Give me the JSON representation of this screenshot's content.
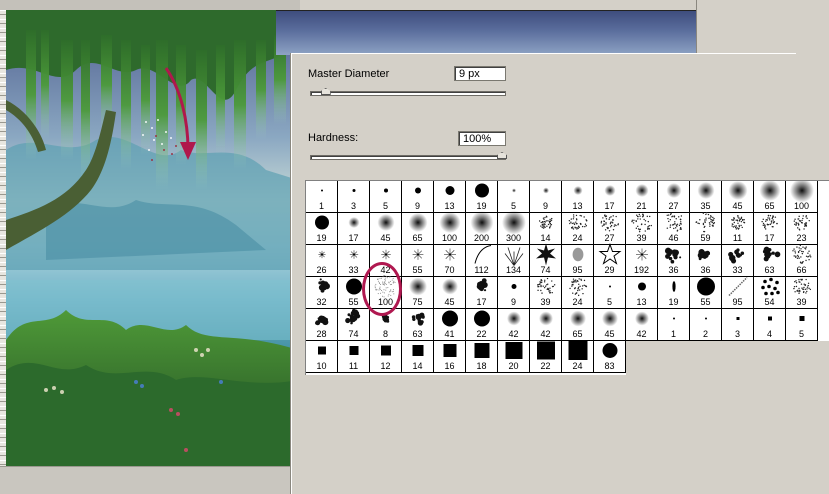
{
  "palette": {
    "master_diameter": {
      "label": "Master Diameter",
      "value": "9 px",
      "fraction": 0.05
    },
    "hardness": {
      "label": "Hardness:",
      "value": "100%",
      "fraction": 1.0
    }
  },
  "brushes": {
    "rows": [
      [
        {
          "n": "1",
          "k": "hard",
          "s": 2
        },
        {
          "n": "3",
          "k": "hard",
          "s": 3
        },
        {
          "n": "5",
          "k": "hard",
          "s": 4
        },
        {
          "n": "9",
          "k": "hard",
          "s": 6
        },
        {
          "n": "13",
          "k": "hard",
          "s": 9
        },
        {
          "n": "19",
          "k": "hard",
          "s": 14
        },
        {
          "n": "5",
          "k": "soft",
          "s": 4
        },
        {
          "n": "9",
          "k": "soft",
          "s": 6
        },
        {
          "n": "13",
          "k": "soft",
          "s": 9
        },
        {
          "n": "17",
          "k": "soft",
          "s": 11
        },
        {
          "n": "21",
          "k": "soft",
          "s": 13
        },
        {
          "n": "27",
          "k": "soft",
          "s": 15
        },
        {
          "n": "35",
          "k": "soft",
          "s": 17
        },
        {
          "n": "45",
          "k": "soft",
          "s": 19
        },
        {
          "n": "65",
          "k": "soft",
          "s": 21
        },
        {
          "n": "100",
          "k": "soft",
          "s": 24
        }
      ],
      [
        {
          "n": "19",
          "k": "hard",
          "s": 14
        },
        {
          "n": "17",
          "k": "soft",
          "s": 11
        },
        {
          "n": "45",
          "k": "soft",
          "s": 17
        },
        {
          "n": "65",
          "k": "soft",
          "s": 19
        },
        {
          "n": "100",
          "k": "soft",
          "s": 21
        },
        {
          "n": "200",
          "k": "soft",
          "s": 23
        },
        {
          "n": "300",
          "k": "soft",
          "s": 24
        },
        {
          "n": "14",
          "k": "scatter",
          "s": 14
        },
        {
          "n": "24",
          "k": "scatter",
          "s": 18
        },
        {
          "n": "27",
          "k": "scatter",
          "s": 18
        },
        {
          "n": "39",
          "k": "scatter",
          "s": 20
        },
        {
          "n": "46",
          "k": "scatter",
          "s": 20
        },
        {
          "n": "59",
          "k": "scatter",
          "s": 20
        },
        {
          "n": "11",
          "k": "scatter",
          "s": 14
        },
        {
          "n": "17",
          "k": "scatter",
          "s": 16
        },
        {
          "n": "23",
          "k": "scatter",
          "s": 16
        }
      ],
      [
        {
          "n": "26",
          "k": "star",
          "s": 12
        },
        {
          "n": "33",
          "k": "star",
          "s": 14
        },
        {
          "n": "42",
          "k": "star",
          "s": 16
        },
        {
          "n": "55",
          "k": "star",
          "s": 18
        },
        {
          "n": "70",
          "k": "star",
          "s": 20
        },
        {
          "n": "112",
          "k": "curve",
          "s": 22
        },
        {
          "n": "134",
          "k": "grass",
          "s": 22
        },
        {
          "n": "74",
          "k": "leaf",
          "s": 18
        },
        {
          "n": "95",
          "k": "gleaf",
          "s": 18
        },
        {
          "n": "29",
          "k": "outline-star",
          "s": 18
        },
        {
          "n": "192",
          "k": "star",
          "s": 20
        },
        {
          "n": "36",
          "k": "splat",
          "s": 20
        },
        {
          "n": "36",
          "k": "splat",
          "s": 20
        },
        {
          "n": "33",
          "k": "splat",
          "s": 20
        },
        {
          "n": "63",
          "k": "splat",
          "s": 20
        },
        {
          "n": "66",
          "k": "scatter",
          "s": 20
        }
      ],
      [
        {
          "n": "32",
          "k": "splat",
          "s": 20
        },
        {
          "n": "55",
          "k": "hard",
          "s": 16
        },
        {
          "n": "100",
          "k": "noise",
          "s": 22
        },
        {
          "n": "75",
          "k": "soft",
          "s": 18
        },
        {
          "n": "45",
          "k": "soft",
          "s": 16
        },
        {
          "n": "17",
          "k": "splat",
          "s": 16
        },
        {
          "n": "9",
          "k": "hard",
          "s": 5
        },
        {
          "n": "39",
          "k": "scatter",
          "s": 18
        },
        {
          "n": "24",
          "k": "scatter",
          "s": 18
        },
        {
          "n": "5",
          "k": "hard",
          "s": 2
        },
        {
          "n": "13",
          "k": "hard",
          "s": 8
        },
        {
          "n": "19",
          "k": "blade",
          "s": 18
        },
        {
          "n": "55",
          "k": "hard",
          "s": 18
        },
        {
          "n": "95",
          "k": "dash",
          "s": 22
        },
        {
          "n": "54",
          "k": "dots",
          "s": 20
        },
        {
          "n": "39",
          "k": "scatter",
          "s": 18
        }
      ],
      [
        {
          "n": "28",
          "k": "splat",
          "s": 18
        },
        {
          "n": "74",
          "k": "splat",
          "s": 20
        },
        {
          "n": "8",
          "k": "splat",
          "s": 10
        },
        {
          "n": "63",
          "k": "splat",
          "s": 18
        },
        {
          "n": "41",
          "k": "hard",
          "s": 16
        },
        {
          "n": "22",
          "k": "hard",
          "s": 16
        },
        {
          "n": "42",
          "k": "soft",
          "s": 14
        },
        {
          "n": "42",
          "k": "soft",
          "s": 14
        },
        {
          "n": "65",
          "k": "soft",
          "s": 16
        },
        {
          "n": "45",
          "k": "soft",
          "s": 16
        },
        {
          "n": "42",
          "k": "soft",
          "s": 14
        },
        {
          "n": "1",
          "k": "hard",
          "s": 2
        },
        {
          "n": "2",
          "k": "hard",
          "s": 2
        },
        {
          "n": "3",
          "k": "square",
          "s": 3
        },
        {
          "n": "4",
          "k": "square",
          "s": 4
        },
        {
          "n": "5",
          "k": "square",
          "s": 5
        }
      ],
      [
        {
          "n": "10",
          "k": "square",
          "s": 8
        },
        {
          "n": "11",
          "k": "square",
          "s": 9
        },
        {
          "n": "12",
          "k": "square",
          "s": 10
        },
        {
          "n": "14",
          "k": "square",
          "s": 11
        },
        {
          "n": "16",
          "k": "square",
          "s": 13
        },
        {
          "n": "18",
          "k": "square",
          "s": 15
        },
        {
          "n": "20",
          "k": "square",
          "s": 17
        },
        {
          "n": "22",
          "k": "square",
          "s": 18
        },
        {
          "n": "24",
          "k": "square",
          "s": 19
        },
        {
          "n": "83",
          "k": "hard",
          "s": 15
        }
      ]
    ],
    "selected": {
      "row": 3,
      "col": 2
    }
  },
  "colors": {
    "highlight": "#b01850",
    "arrow": "#b0184c"
  }
}
